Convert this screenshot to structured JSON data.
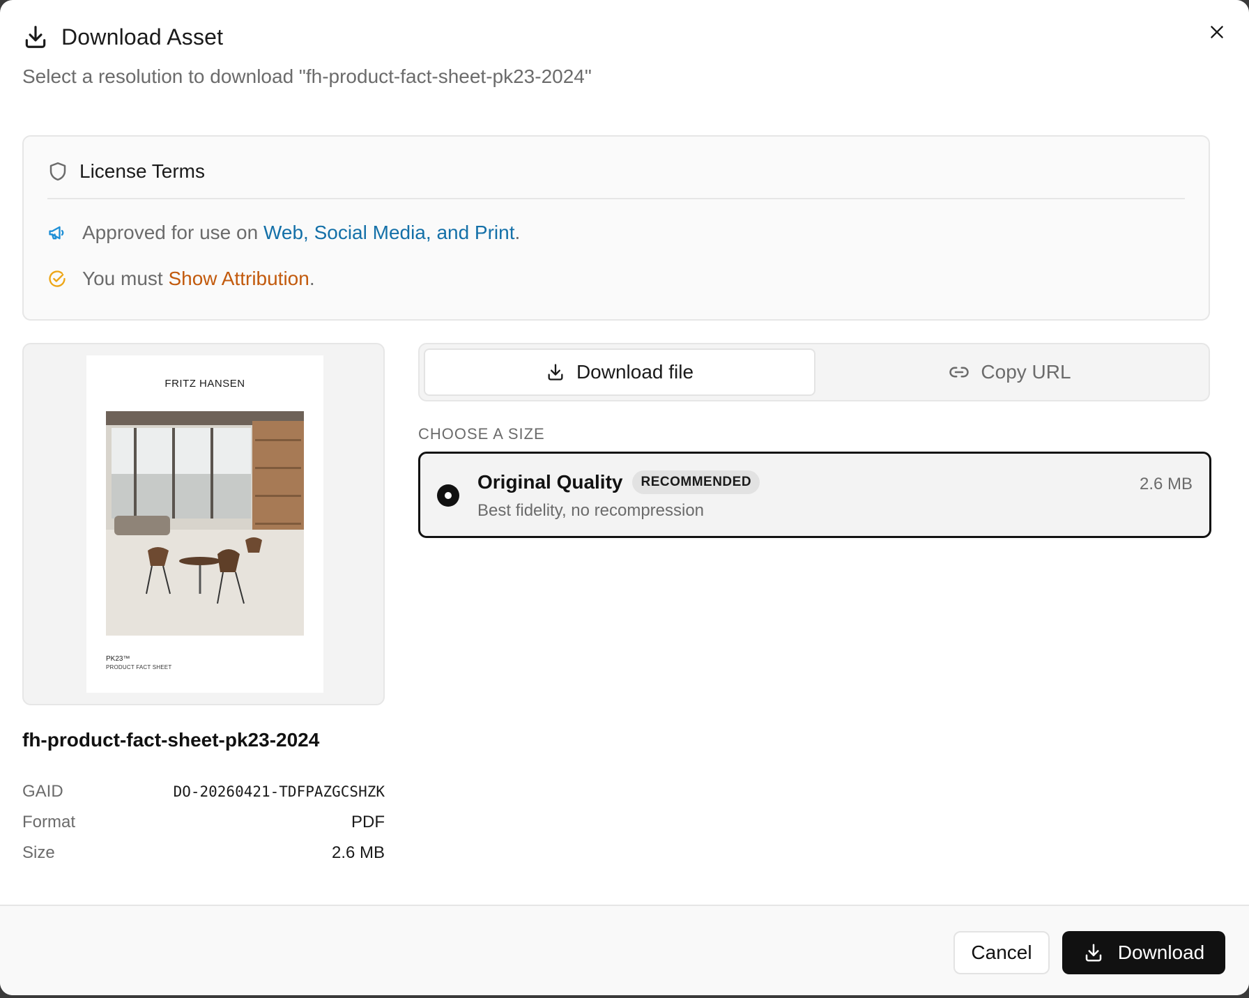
{
  "dialog": {
    "title": "Download Asset",
    "subtitle": "Select a resolution to download \"fh-product-fact-sheet-pk23-2024\"",
    "close_icon": "close-icon"
  },
  "license": {
    "title": "License Terms",
    "approved_prefix": "Approved for use on ",
    "approved_channels": "Web, Social Media, and Print",
    "approved_suffix": ".",
    "attribution_prefix": "You must ",
    "attribution_requirement": "Show Attribution",
    "attribution_suffix": ".",
    "colors": {
      "channels": "#1470a8",
      "attribution": "#c25a0d"
    }
  },
  "preview": {
    "brand": "FRITZ HANSEN",
    "product_code": "PK23™",
    "product_subtitle": "PRODUCT FACT SHEET"
  },
  "asset": {
    "name": "fh-product-fact-sheet-pk23-2024",
    "meta": [
      {
        "key": "GAID",
        "value": "DO-20260421-TDFPAZGCSHZK"
      },
      {
        "key": "Format",
        "value": "PDF"
      },
      {
        "key": "Size",
        "value": "2.6 MB"
      }
    ]
  },
  "tabs": {
    "download_file": "Download file",
    "copy_url": "Copy URL",
    "active": "download_file"
  },
  "sizes": {
    "label": "CHOOSE A SIZE",
    "options": [
      {
        "title": "Original Quality",
        "badge": "RECOMMENDED",
        "description": "Best fidelity, no recompression",
        "size": "2.6 MB",
        "selected": true
      }
    ]
  },
  "footer": {
    "cancel_label": "Cancel",
    "download_label": "Download"
  }
}
